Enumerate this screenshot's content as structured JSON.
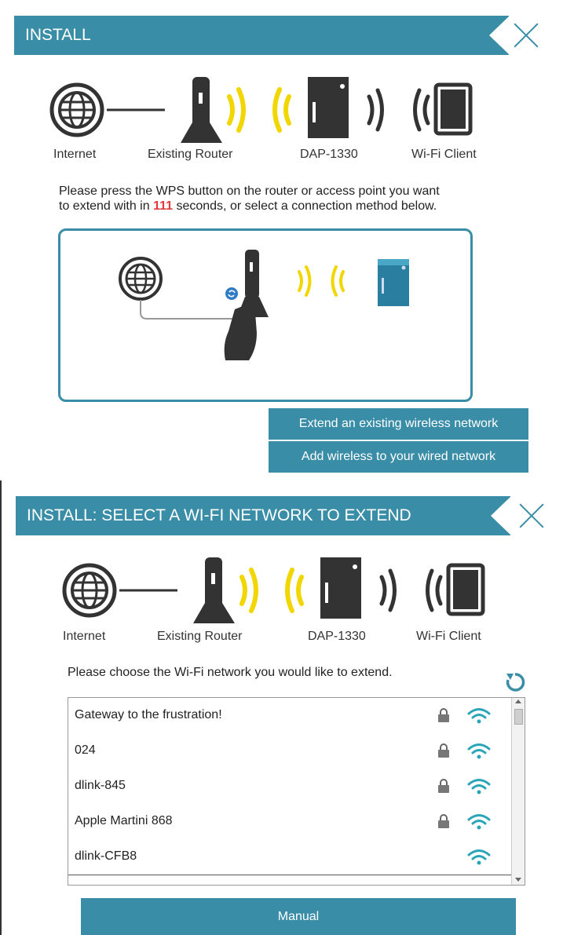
{
  "panel1": {
    "title": "INSTALL",
    "topology": {
      "internet": "Internet",
      "router": "Existing Router",
      "extender": "DAP-1330",
      "client": "Wi-Fi Client"
    },
    "instruction_line1": "Please press the WPS button on the router or access point you want",
    "instruction_pre": "to extend with in ",
    "countdown": "111",
    "instruction_post": " seconds, or select a connection method below.",
    "buttons": {
      "extend": "Extend an existing wireless network",
      "add_wireless": "Add wireless to your wired network"
    }
  },
  "panel2": {
    "title": "INSTALL: SELECT A WI-FI NETWORK TO EXTEND",
    "topology": {
      "internet": "Internet",
      "router": "Existing Router",
      "extender": "DAP-1330",
      "client": "Wi-Fi Client"
    },
    "instruction": "Please choose the Wi-Fi network you would like to extend.",
    "networks": [
      {
        "ssid": "Gateway to the frustration!",
        "secured": true
      },
      {
        "ssid": "024",
        "secured": true
      },
      {
        "ssid": "dlink-845",
        "secured": true
      },
      {
        "ssid": "Apple Martini 868",
        "secured": true
      },
      {
        "ssid": "dlink-CFB8",
        "secured": false
      }
    ],
    "manual_label": "Manual"
  },
  "colors": {
    "accent": "#3a8da6",
    "wave": "#f2d600",
    "countdown": "#e23b3b"
  }
}
